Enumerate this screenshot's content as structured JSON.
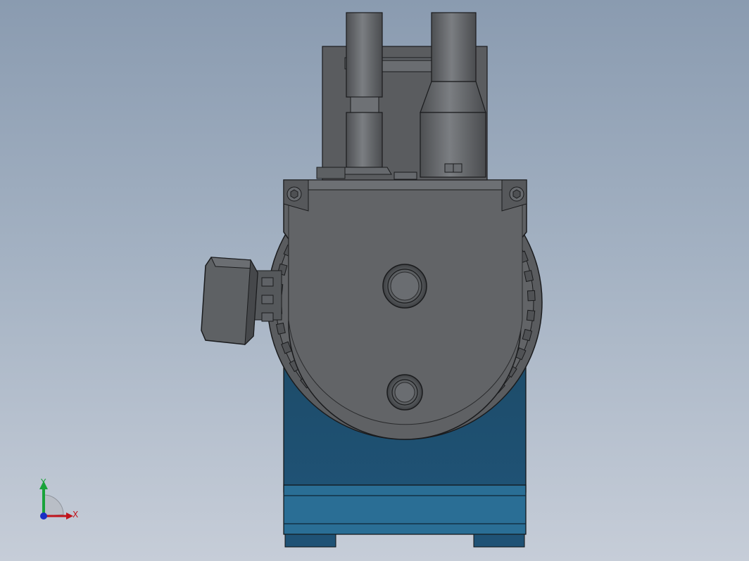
{
  "scene": {
    "description_free": true,
    "colors": {
      "background_top": "#8a9bb0",
      "background_bottom": "#c6cdd8",
      "part_gray": "#5f6164",
      "part_gray_light": "#75787c",
      "part_edge": "#1e1f21",
      "body_blue": "#1e4d6b",
      "base_blue": "#2a6f96"
    }
  },
  "triad": {
    "x_label": "X",
    "y_label": "Y",
    "x_color": "#c0141c",
    "y_color": "#19a33a",
    "z_color": "#1a2fc4"
  }
}
